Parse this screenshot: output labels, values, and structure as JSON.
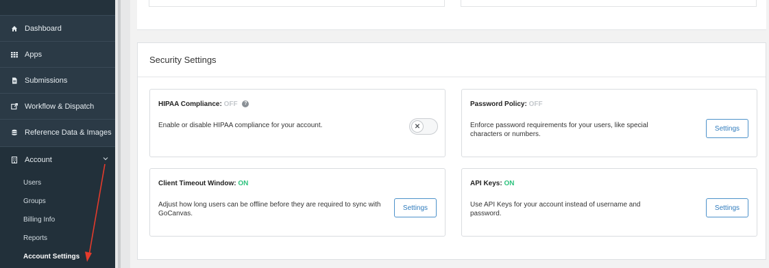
{
  "sidebar": {
    "items": [
      {
        "label": "Dashboard",
        "icon": "home-icon"
      },
      {
        "label": "Apps",
        "icon": "grid-icon"
      },
      {
        "label": "Submissions",
        "icon": "document-icon"
      },
      {
        "label": "Workflow & Dispatch",
        "icon": "dispatch-icon"
      },
      {
        "label": "Reference Data & Images",
        "icon": "database-icon"
      },
      {
        "label": "Account",
        "icon": "building-icon"
      }
    ],
    "sub_items": [
      "Users",
      "Groups",
      "Billing Info",
      "Reports",
      "Account Settings"
    ],
    "active_sub_item": "Account Settings"
  },
  "security": {
    "title": "Security Settings",
    "cards": [
      {
        "title": "HIPAA Compliance:",
        "status": "OFF",
        "description": "Enable or disable HIPAA compliance for your account.",
        "control": "toggle"
      },
      {
        "title": "Password Policy:",
        "status": "OFF",
        "description": "Enforce password requirements for your users, like special characters or numbers.",
        "button": "Settings"
      },
      {
        "title": "Client Timeout Window:",
        "status": "ON",
        "description": "Adjust how long users can be offline before they are required to sync with GoCanvas.",
        "button": "Settings"
      },
      {
        "title": "API Keys:",
        "status": "ON",
        "description": "Use API Keys for your account instead of username and password.",
        "button": "Settings"
      }
    ]
  },
  "colors": {
    "sidebar_bg": "#2b3a46",
    "status_on": "#2ec27e",
    "status_off": "#c4c8cc",
    "button_text": "#2f7bbd",
    "annotation_arrow": "#e53b2c"
  }
}
